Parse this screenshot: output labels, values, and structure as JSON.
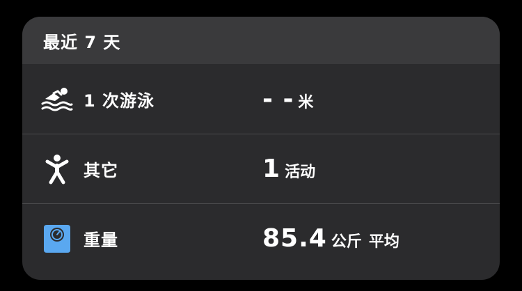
{
  "card": {
    "title": "最近 7 天",
    "colors": {
      "background": "#2b2b2d",
      "header": "#3a3a3c",
      "divider": "#4a4a4c",
      "scale_accent": "#5aa8f0"
    },
    "rows": [
      {
        "icon": "swimmer-icon",
        "label": "1 次游泳",
        "value": "- -",
        "unit": "米"
      },
      {
        "icon": "activity-person-icon",
        "label": "其它",
        "value": "1",
        "unit": "活动"
      },
      {
        "icon": "weight-scale-icon",
        "label": "重量",
        "value": "85.4",
        "unit": "公斤",
        "suffix": "平均"
      }
    ]
  }
}
